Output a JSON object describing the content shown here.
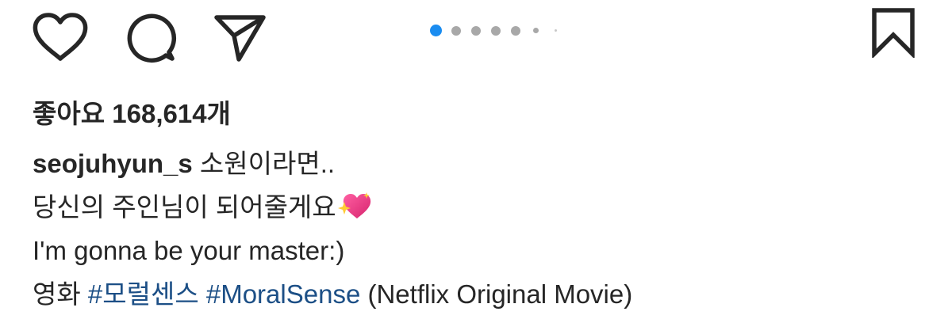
{
  "actions": {
    "like_icon": "heart-outline-icon",
    "comment_icon": "comment-bubble-icon",
    "share_icon": "paper-plane-icon",
    "bookmark_icon": "bookmark-outline-icon"
  },
  "carousel": {
    "active_index": 1,
    "dot_count": 7,
    "active_color": "#1a8cf0",
    "inactive_color": "#a8a8a8"
  },
  "likes": {
    "label": "좋아요",
    "count": "168,614개"
  },
  "caption": {
    "username": "seojuhyun_s",
    "line1_text": " 소원이라면..",
    "line2_text": "당신의 주인님이 되어줄게요",
    "line2_emoji": "sparkling-heart-icon",
    "line3_text": "I'm gonna be your master:)",
    "line4_prefix": "영화 ",
    "hashtag1": "#모럴센스",
    "hashtag2": "#MoralSense",
    "line4_suffix": " (Netflix Original Movie)",
    "hashtag_color": "#1c4f86"
  }
}
